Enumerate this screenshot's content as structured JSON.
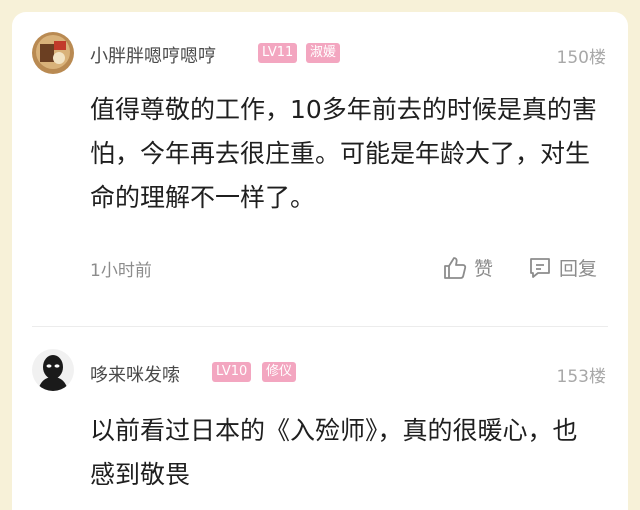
{
  "comments": [
    {
      "username": "小胖胖嗯哼嗯哼",
      "level": "LV11",
      "title": "淑媛",
      "floor": "150楼",
      "content": "值得尊敬的工作，10多年前去的时候是真的害怕，今年再去很庄重。可能是年龄大了，对生命的理解不一样了。",
      "time": "1小时前",
      "like_label": "赞",
      "reply_label": "回复"
    },
    {
      "username": "哆来咪发嗦",
      "level": "LV10",
      "title": "修仪",
      "floor": "153楼",
      "content": "以前看过日本的《入殓师》，真的很暖心，也感到敬畏"
    }
  ],
  "colors": {
    "page_background": "#f7f1d8",
    "badge": "#f3a6c0",
    "muted_text": "#8c8c8c"
  },
  "icons": [
    "thumbs-up-icon",
    "comment-icon"
  ]
}
